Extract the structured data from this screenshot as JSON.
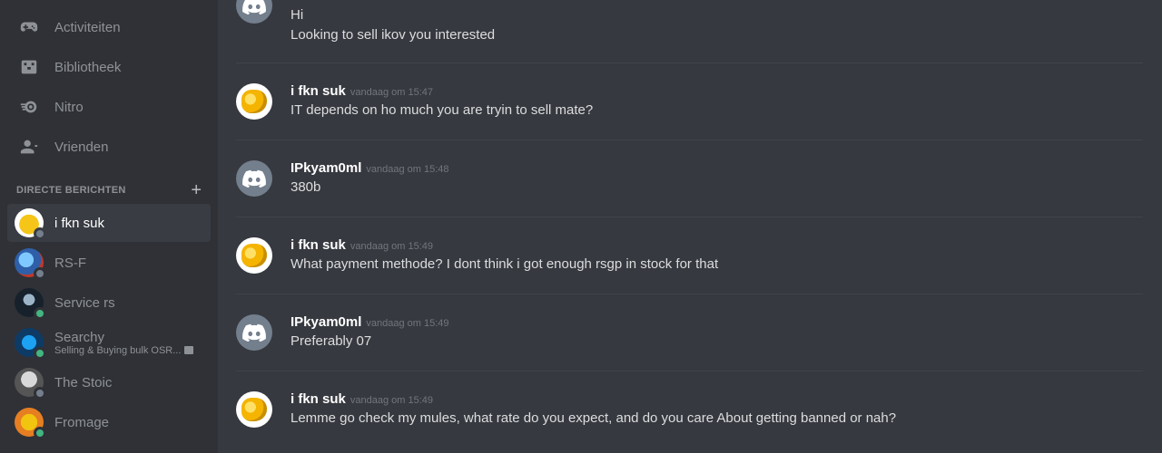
{
  "sidebar": {
    "nav": [
      {
        "label": "Activiteiten",
        "icon": "gamepad-icon"
      },
      {
        "label": "Bibliotheek",
        "icon": "library-icon"
      },
      {
        "label": "Nitro",
        "icon": "nitro-icon"
      },
      {
        "label": "Vrienden",
        "icon": "friends-icon"
      }
    ],
    "dm_header": "DIRECTE BERICHTEN",
    "dms": [
      {
        "name": "i fkn suk",
        "status": "offline",
        "active": true
      },
      {
        "name": "RS-F",
        "status": "offline"
      },
      {
        "name": "Service rs",
        "status": "online"
      },
      {
        "name": "Searchy",
        "sub": "Selling & Buying bulk OSR...",
        "status": "online"
      },
      {
        "name": "The Stoic",
        "status": "offline"
      },
      {
        "name": "Fromage",
        "status": "online"
      }
    ]
  },
  "messages": [
    {
      "lines": [
        "Hi",
        "Looking to sell ikov you interested"
      ]
    },
    {
      "author": "i fkn suk",
      "time": "vandaag om 15:47",
      "text": "IT depends on ho much you are tryin to sell mate?"
    },
    {
      "author": "IPkyam0ml",
      "time": "vandaag om 15:48",
      "text": "380b"
    },
    {
      "author": "i fkn suk",
      "time": "vandaag om 15:49",
      "text": "What payment methode? I dont think i got enough rsgp in stock for that"
    },
    {
      "author": "IPkyam0ml",
      "time": "vandaag om 15:49",
      "text": "Preferably 07"
    },
    {
      "author": "i fkn suk",
      "time": "vandaag om 15:49",
      "text": "Lemme go check my mules, what rate do you expect, and do you care About getting banned or nah?"
    }
  ]
}
